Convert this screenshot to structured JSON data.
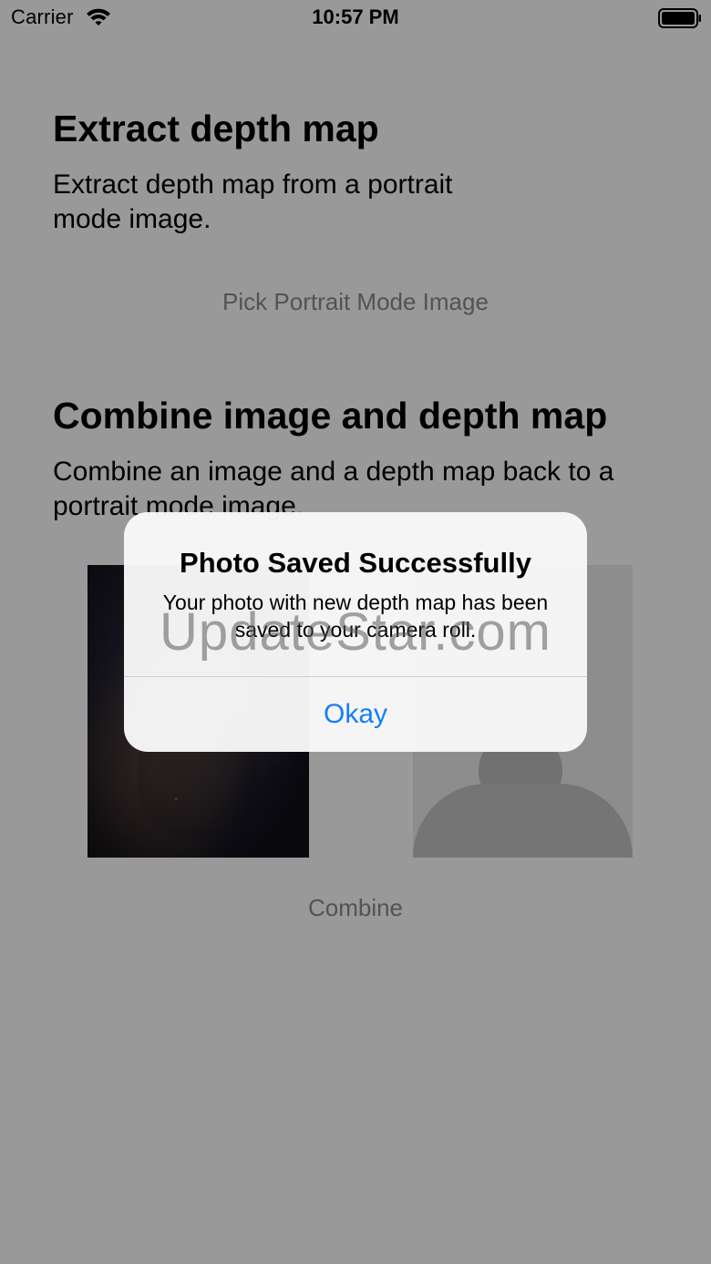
{
  "status_bar": {
    "carrier": "Carrier",
    "time": "10:57 PM",
    "wifi_icon": "wifi-icon",
    "battery_icon": "battery-full-icon"
  },
  "extract_section": {
    "title": "Extract depth map",
    "description": "Extract depth map from a portrait mode image.",
    "button_label": "Pick Portrait Mode Image"
  },
  "combine_section": {
    "title": "Combine image and depth map",
    "description": "Combine an image and a depth map back to a portrait mode image.",
    "button_label": "Combine"
  },
  "alert": {
    "title": "Photo Saved Successfully",
    "message": "Your photo with new depth map has been saved to your camera roll.",
    "button_label": "Okay"
  },
  "watermark": "UpdateStar.com",
  "colors": {
    "accent": "#157efb",
    "overlay": "rgba(0,0,0,0.40)"
  }
}
